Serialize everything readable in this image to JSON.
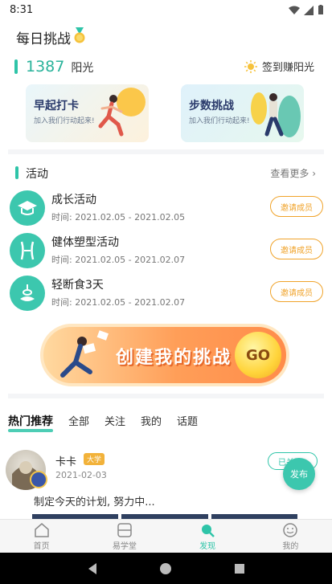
{
  "status_bar": {
    "time": "8:31"
  },
  "header": {
    "title": "每日挑战"
  },
  "points": {
    "value": "1387",
    "unit": "阳光",
    "checkin_label": "签到赚阳光"
  },
  "cards": [
    {
      "title": "早起打卡",
      "subtitle": "加入我们行动起来!"
    },
    {
      "title": "步数挑战",
      "subtitle": "加入我们行动起来!"
    }
  ],
  "activities_section": {
    "title": "活动",
    "more_label": "查看更多"
  },
  "activities": [
    {
      "name": "成长活动",
      "time": "时间: 2021.02.05 - 2021.02.05",
      "button": "邀请成员",
      "icon": "graduation-cap-icon"
    },
    {
      "name": "健体塑型活动",
      "time": "时间: 2021.02.05 - 2021.02.07",
      "button": "邀请成员",
      "icon": "body-shape-icon"
    },
    {
      "name": "轻断食3天",
      "time": "时间: 2021.02.05 - 2021.02.07",
      "button": "邀请成员",
      "icon": "fasting-icon"
    }
  ],
  "banner": {
    "text": "创建我的挑战",
    "go_label": "GO"
  },
  "tabs": [
    {
      "label": "热门推荐",
      "active": true
    },
    {
      "label": "全部"
    },
    {
      "label": "关注"
    },
    {
      "label": "我的"
    },
    {
      "label": "话题"
    }
  ],
  "post": {
    "user": "卡卡",
    "tag": "大学",
    "date": "2021-02-03",
    "text": "制定今天的计划, 努力中...",
    "follow_label": "已关注"
  },
  "fab_label": "发布",
  "bottom_nav": [
    {
      "label": "首页",
      "icon": "home-icon"
    },
    {
      "label": "易学堂",
      "icon": "book-icon"
    },
    {
      "label": "发现",
      "icon": "discover-icon",
      "active": true
    },
    {
      "label": "我的",
      "icon": "profile-icon"
    }
  ],
  "colors": {
    "accent": "#2ec4a8",
    "orange": "#f0a32a"
  }
}
